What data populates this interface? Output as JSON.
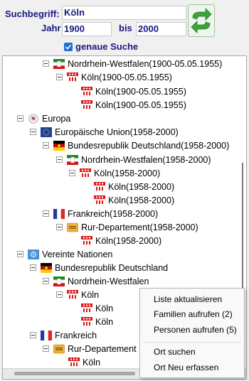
{
  "search": {
    "term_label": "Suchbegriff:",
    "term_value": "Köln",
    "year_label": "Jahr",
    "year_from": "1900",
    "to_label": "bis",
    "year_to": "2000",
    "exact_label": "genaue Suche",
    "exact_checked": true
  },
  "tree": [
    {
      "label": "Nordrhein-Westfalen(1900-05.05.1955)",
      "icon": "nrw-flag-icon"
    },
    {
      "label": "Köln(1900-05.05.1955)",
      "icon": "cologne-coat-of-arms-icon"
    },
    {
      "label": "Köln(1900-05.05.1955)",
      "icon": "cologne-coat-of-arms-icon"
    },
    {
      "label": "Köln(1900-05.05.1955)",
      "icon": "cologne-coat-of-arms-icon"
    },
    {
      "label": "Europa",
      "icon": "europe-globe-icon"
    },
    {
      "label": "Europäische Union(1958-2000)",
      "icon": "eu-flag-icon"
    },
    {
      "label": "Bundesrepublik Deutschland(1958-2000)",
      "icon": "germany-flag-icon"
    },
    {
      "label": "Nordrhein-Westfalen(1958-2000)",
      "icon": "nrw-flag-icon"
    },
    {
      "label": "Köln(1958-2000)",
      "icon": "cologne-coat-of-arms-icon"
    },
    {
      "label": "Köln(1958-2000)",
      "icon": "cologne-coat-of-arms-icon"
    },
    {
      "label": "Köln(1958-2000)",
      "icon": "cologne-coat-of-arms-icon"
    },
    {
      "label": "Frankreich(1958-2000)",
      "icon": "france-flag-icon"
    },
    {
      "label": "Rur-Departement(1958-2000)",
      "icon": "department-sign-icon"
    },
    {
      "label": "Köln(1958-2000)",
      "icon": "cologne-coat-of-arms-icon"
    },
    {
      "label": "Vereinte Nationen",
      "icon": "un-flag-icon"
    },
    {
      "label": "Bundesrepublik Deutschland",
      "icon": "germany-flag-icon"
    },
    {
      "label": "Nordrhein-Westfalen",
      "icon": "nrw-flag-icon"
    },
    {
      "label": "Köln",
      "icon": "cologne-coat-of-arms-icon"
    },
    {
      "label": "Köln",
      "icon": "cologne-coat-of-arms-icon"
    },
    {
      "label": "Köln",
      "icon": "cologne-coat-of-arms-icon"
    },
    {
      "label": "Frankreich",
      "icon": "france-flag-icon"
    },
    {
      "label": "Rur-Departement",
      "icon": "department-sign-icon"
    },
    {
      "label": "Köln",
      "icon": "cologne-coat-of-arms-icon"
    }
  ],
  "context_menu": {
    "items": [
      "Liste aktualisieren",
      "Familien aufrufen (2)",
      "Personen aufrufen (5)",
      "Ort suchen",
      "Ort Neu erfassen"
    ]
  },
  "colors": {
    "label_text": "#1a1a7e",
    "checkbox_accent": "#1f6fd1",
    "swap_button_green": "#3aa43a"
  }
}
